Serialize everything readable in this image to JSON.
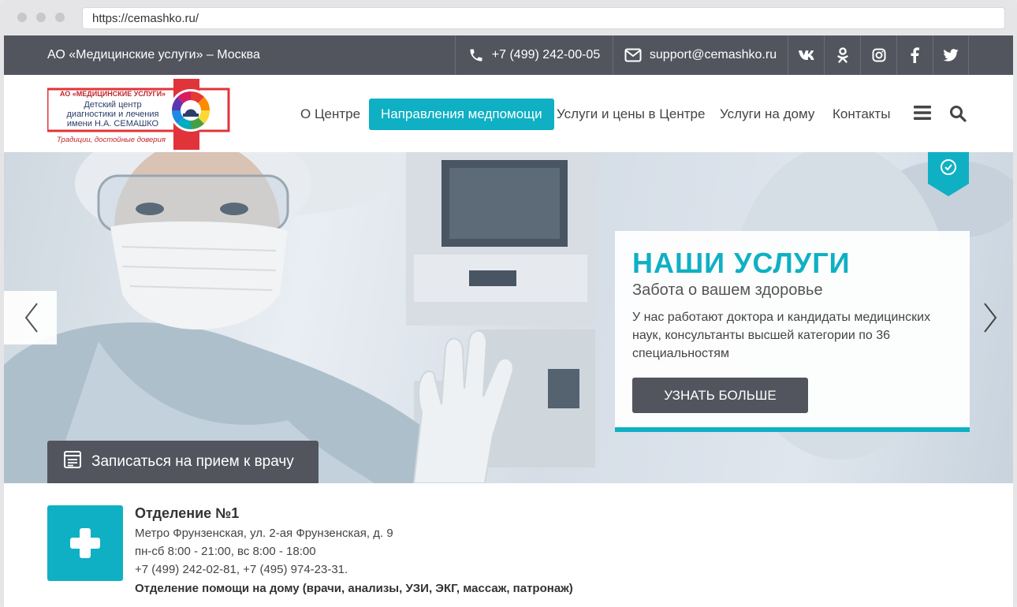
{
  "browser": {
    "url": "https://cemashko.ru/"
  },
  "topbar": {
    "org_name": "АО «Медицинские услуги» – Москва",
    "phone": "+7 (499) 242-00-05",
    "email": "support@cemashko.ru"
  },
  "logo": {
    "org": "АО «МЕДИЦИНСКИЕ УСЛУГИ»",
    "line1": "Детский центр",
    "line2": "диагностики и лечения",
    "line3": "имени Н.А. СЕМАШКО",
    "slogan": "Традиции, достойные доверия"
  },
  "nav": {
    "items": [
      {
        "label": "О Центре"
      },
      {
        "label": "Направления медпомощи"
      },
      {
        "label": "Услуги и цены в Центре"
      },
      {
        "label": "Услуги на дому"
      },
      {
        "label": "Контакты"
      }
    ]
  },
  "hero": {
    "title": "НАШИ УСЛУГИ",
    "subtitle": "Забота о вашем здоровье",
    "description": "У нас работают доктора и кандидаты медицинских наук, консультанты высшей категории по 36 специальностям",
    "cta": "УЗНАТЬ БОЛЬШЕ",
    "appointment": "Записаться на прием к врачу"
  },
  "branch": {
    "title": "Отделение №1",
    "address": "Метро Фрунзенская, ул. 2-ая Фрунзенская, д. 9",
    "hours": "пн-сб 8:00 - 21:00, вс 8:00 - 18:00",
    "phones": "+7 (499) 242-02-81, +7 (495) 974-23-31.",
    "home_care": "Отделение помощи на дому (врачи, анализы, УЗИ, ЭКГ, массаж, патронаж)"
  },
  "colors": {
    "accent": "#0fb0c4",
    "dark": "#52555e",
    "logo_red": "#e0343a"
  }
}
